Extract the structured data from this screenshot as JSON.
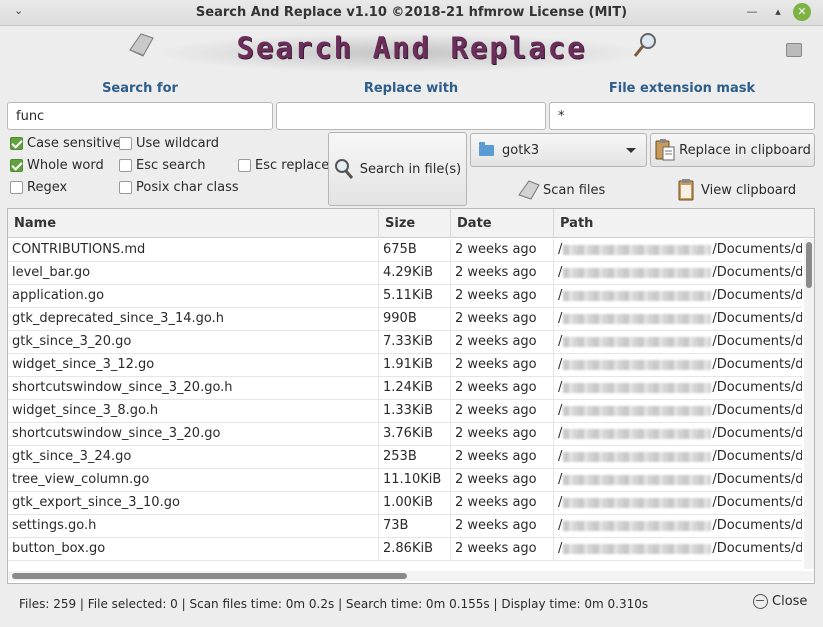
{
  "window": {
    "title": "Search And Replace v1.10  ©2018-21 hfmrow License (MIT)",
    "menu_glyph": "⌄",
    "min_glyph": "—",
    "max_glyph": "▴",
    "close_glyph": "✕"
  },
  "banner": {
    "brand_text": "Search And Replace"
  },
  "labels": {
    "search_for": "Search for",
    "replace_with": "Replace with",
    "file_ext_mask": "File extension mask"
  },
  "inputs": {
    "search_value": "func",
    "replace_value": "",
    "mask_value": "*"
  },
  "options": {
    "case_sensitive": {
      "label": "Case sensitive",
      "checked": true
    },
    "use_wildcard": {
      "label": "Use wildcard",
      "checked": false
    },
    "whole_word": {
      "label": "Whole word",
      "checked": true
    },
    "esc_search": {
      "label": "Esc search",
      "checked": false
    },
    "esc_replace": {
      "label": "Esc replace",
      "checked": false
    },
    "regex": {
      "label": "Regex",
      "checked": false
    },
    "posix_char_class": {
      "label": "Posix char class",
      "checked": false
    }
  },
  "buttons": {
    "search_in_files": "Search in file(s)",
    "folder_selected": "gotk3",
    "replace_in_clipboard": "Replace in clipboard",
    "scan_files": "Scan files",
    "view_clipboard": "View clipboard",
    "close": "Close"
  },
  "table": {
    "columns": [
      "Name",
      "Size",
      "Date",
      "Path"
    ],
    "rows": [
      {
        "name": "CONTRIBUTIONS.md",
        "size": "675B",
        "date": "2 weeks ago",
        "path_prefix": "/",
        "path_suffix": "/Documents/de"
      },
      {
        "name": "level_bar.go",
        "size": "4.29KiB",
        "date": "2 weeks ago",
        "path_prefix": "/",
        "path_suffix": "/Documents/de"
      },
      {
        "name": "application.go",
        "size": "5.11KiB",
        "date": "2 weeks ago",
        "path_prefix": "/",
        "path_suffix": "/Documents/de"
      },
      {
        "name": "gtk_deprecated_since_3_14.go.h",
        "size": "990B",
        "date": "2 weeks ago",
        "path_prefix": "/",
        "path_suffix": "/Documents/de"
      },
      {
        "name": "gtk_since_3_20.go",
        "size": "7.33KiB",
        "date": "2 weeks ago",
        "path_prefix": "/",
        "path_suffix": "/Documents/de"
      },
      {
        "name": "widget_since_3_12.go",
        "size": "1.91KiB",
        "date": "2 weeks ago",
        "path_prefix": "/",
        "path_suffix": "/Documents/de"
      },
      {
        "name": "shortcutswindow_since_3_20.go.h",
        "size": "1.24KiB",
        "date": "2 weeks ago",
        "path_prefix": "/",
        "path_suffix": "/Documents/de"
      },
      {
        "name": "widget_since_3_8.go.h",
        "size": "1.33KiB",
        "date": "2 weeks ago",
        "path_prefix": "/",
        "path_suffix": "/Documents/de"
      },
      {
        "name": "shortcutswindow_since_3_20.go",
        "size": "3.76KiB",
        "date": "2 weeks ago",
        "path_prefix": "/",
        "path_suffix": "/Documents/de"
      },
      {
        "name": "gtk_since_3_24.go",
        "size": "253B",
        "date": "2 weeks ago",
        "path_prefix": "/",
        "path_suffix": "/Documents/de"
      },
      {
        "name": "tree_view_column.go",
        "size": "11.10KiB",
        "date": "2 weeks ago",
        "path_prefix": "/",
        "path_suffix": "/Documents/de"
      },
      {
        "name": "gtk_export_since_3_10.go",
        "size": "1.00KiB",
        "date": "2 weeks ago",
        "path_prefix": "/",
        "path_suffix": "/Documents/de"
      },
      {
        "name": "settings.go.h",
        "size": "73B",
        "date": "2 weeks ago",
        "path_prefix": "/",
        "path_suffix": "/Documents/de"
      },
      {
        "name": "button_box.go",
        "size": "2.86KiB",
        "date": "2 weeks ago",
        "path_prefix": "/",
        "path_suffix": "/Documents/de"
      }
    ]
  },
  "status": {
    "text": "Files: 259 | File selected: 0 | Scan files time: 0m 0.2s | Search time: 0m 0.155s | Display time: 0m 0.310s"
  },
  "icons": {
    "folder_icon": "folder",
    "magnifier_icon": "magnifier",
    "clipboard_icon": "clipboard",
    "scan_icon": "shield-scan",
    "close_icon": "circle-exit"
  }
}
